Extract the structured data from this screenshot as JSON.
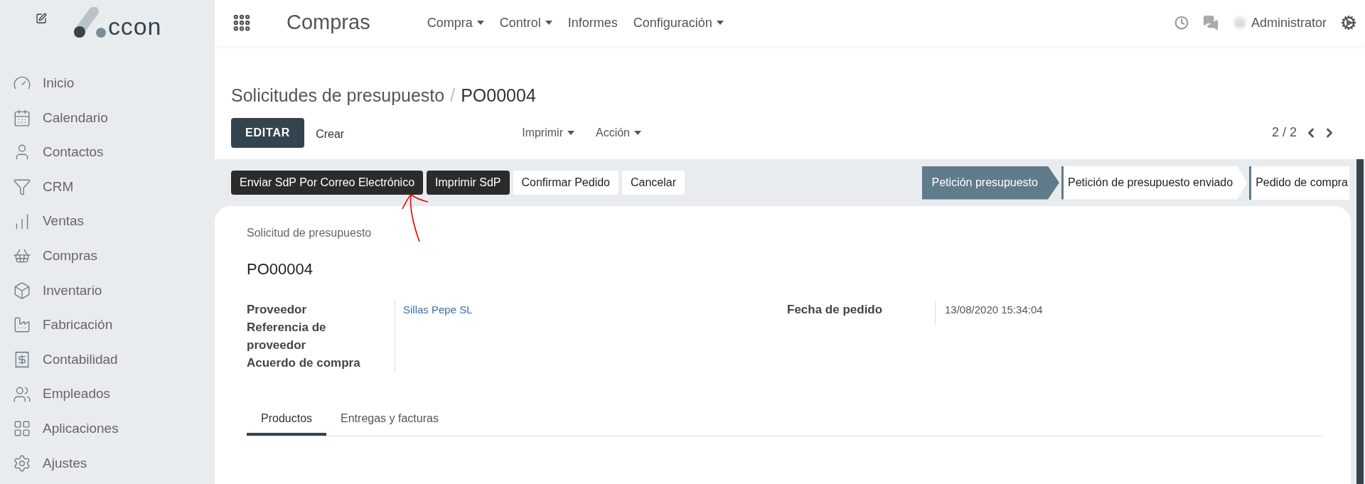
{
  "sidebar": {
    "logo_text": "ccon",
    "items": [
      {
        "label": "Inicio"
      },
      {
        "label": "Calendario"
      },
      {
        "label": "Contactos"
      },
      {
        "label": "CRM"
      },
      {
        "label": "Ventas"
      },
      {
        "label": "Compras"
      },
      {
        "label": "Inventario"
      },
      {
        "label": "Fabricación"
      },
      {
        "label": "Contabilidad"
      },
      {
        "label": "Empleados"
      },
      {
        "label": "Aplicaciones"
      },
      {
        "label": "Ajustes"
      }
    ]
  },
  "top_bar": {
    "app_title": "Compras",
    "menus": [
      {
        "label": "Compra",
        "dropdown": true
      },
      {
        "label": "Control",
        "dropdown": true
      },
      {
        "label": "Informes",
        "dropdown": false
      },
      {
        "label": "Configuración",
        "dropdown": true
      }
    ],
    "user_name": "Administrator"
  },
  "breadcrumb": {
    "parent": "Solicitudes de presupuesto",
    "separator": "/",
    "current": "PO00004"
  },
  "control_panel": {
    "edit_button": "EDITAR",
    "create_button": "Crear",
    "dropdowns": [
      "Imprimir",
      "Acción"
    ],
    "pager": "2 / 2"
  },
  "action_buttons": [
    {
      "label": "Enviar SdP Por Correo Electrónico",
      "kind": "dark"
    },
    {
      "label": "Imprimir SdP",
      "kind": "dark"
    },
    {
      "label": "Confirmar Pedido",
      "kind": "light"
    },
    {
      "label": "Cancelar",
      "kind": "light"
    }
  ],
  "stages": [
    {
      "label": "Petición presupuesto",
      "selected": true
    },
    {
      "label": "Petición de presupuesto enviado",
      "selected": false
    },
    {
      "label": "Pedido de compra",
      "selected": false
    }
  ],
  "form": {
    "subtitle": "Solicitud de presupuesto",
    "name": "PO00004",
    "fields_left": [
      {
        "label": "Proveedor",
        "value": "Sillas Pepe SL"
      },
      {
        "label": "Referencia de proveedor"
      },
      {
        "label": "Acuerdo de compra"
      }
    ],
    "fields_right": [
      {
        "label": "Fecha de pedido",
        "value": "13/08/2020 15:34:04"
      }
    ],
    "tabs": [
      {
        "label": "Productos",
        "selected": true
      },
      {
        "label": "Entregas y facturas",
        "selected": false
      }
    ]
  }
}
